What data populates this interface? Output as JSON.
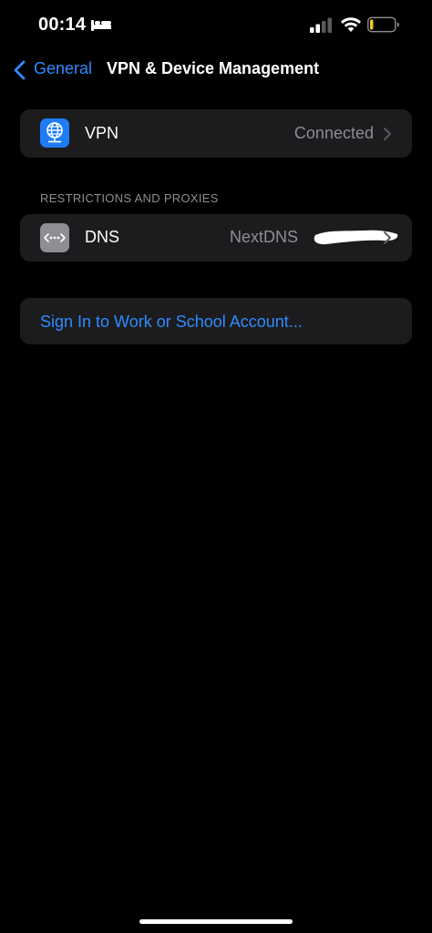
{
  "status_bar": {
    "time": "00:14",
    "icons": [
      "bed-icon",
      "cellular-signal-icon",
      "wifi-icon",
      "battery-icon"
    ]
  },
  "nav": {
    "back_label": "General",
    "title": "VPN & Device Management"
  },
  "vpn_row": {
    "label": "VPN",
    "value": "Connected",
    "icon": "globe-network-icon",
    "icon_color": "#1e7cf6"
  },
  "restrictions_section": {
    "header": "RESTRICTIONS AND PROXIES",
    "dns_row": {
      "label": "DNS",
      "value": "NextDNS",
      "icon": "dns-dots-icon",
      "icon_color": "#8e8e93"
    }
  },
  "account": {
    "link_label": "Sign In to Work or School Account..."
  },
  "colors": {
    "background": "#000000",
    "cell": "#1c1c1e",
    "accent": "#2f8bff",
    "secondary_text": "#8e8e93"
  }
}
